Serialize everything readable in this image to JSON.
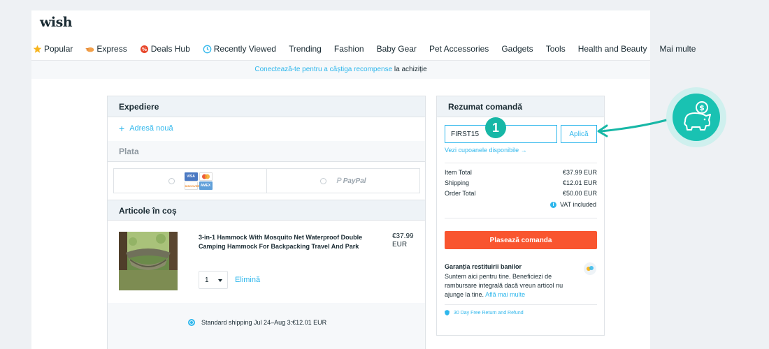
{
  "header": {
    "logo": "wish",
    "nav": [
      {
        "label": "Popular",
        "icon": "star-icon"
      },
      {
        "label": "Express",
        "icon": "express-icon"
      },
      {
        "label": "Deals Hub",
        "icon": "deals-icon"
      },
      {
        "label": "Recently Viewed",
        "icon": "clock-icon"
      },
      {
        "label": "Trending"
      },
      {
        "label": "Fashion"
      },
      {
        "label": "Baby Gear"
      },
      {
        "label": "Pet Accessories"
      },
      {
        "label": "Gadgets"
      },
      {
        "label": "Tools"
      },
      {
        "label": "Health and Beauty"
      },
      {
        "label": "Mai multe"
      }
    ]
  },
  "banner": {
    "link_text": "Conectează-te pentru a câștiga recompense",
    "rest_text": " la achiziție"
  },
  "shipping": {
    "title": "Expediere",
    "add_address": "Adresă nouă",
    "payment_title": "Plata",
    "paypal_label": "PayPal",
    "cart_title": "Articole în coș",
    "product": {
      "title": "3-in-1 Hammock With Mosquito Net Waterproof Double Camping Hammock For Backpacking Travel And Park",
      "price": "€37.99 EUR",
      "quantity": "1",
      "remove": "Elimină"
    },
    "shipping_option": "Standard shipping Jul 24–Aug 3:€12.01 EUR"
  },
  "summary": {
    "title": "Rezumat comandă",
    "coupon_value": "FIRST15",
    "apply": "Aplică",
    "coupons_link": "Vezi cupoanele disponibile →",
    "rows": [
      {
        "label": "Item Total",
        "value": "€37.99 EUR"
      },
      {
        "label": "Shipping",
        "value": "€12.01 EUR"
      },
      {
        "label": "Order Total",
        "value": "€50.00 EUR"
      }
    ],
    "vat": "VAT included",
    "place_order": "Plasează comanda",
    "guarantee_title": "Garanția restituirii banilor",
    "guarantee_text": "Suntem aici pentru tine. Beneficiezi de rambursare integrală dacă vreun articol nu ajunge la tine. ",
    "guarantee_link": "Află mai multe",
    "return_policy": "30 Day Free Return and Refund"
  },
  "annotation": {
    "step": "1",
    "icon": "piggy-bank-icon"
  },
  "colors": {
    "accent": "#2fb7ec",
    "cta": "#f9552f",
    "annotation": "#19c2b2"
  }
}
